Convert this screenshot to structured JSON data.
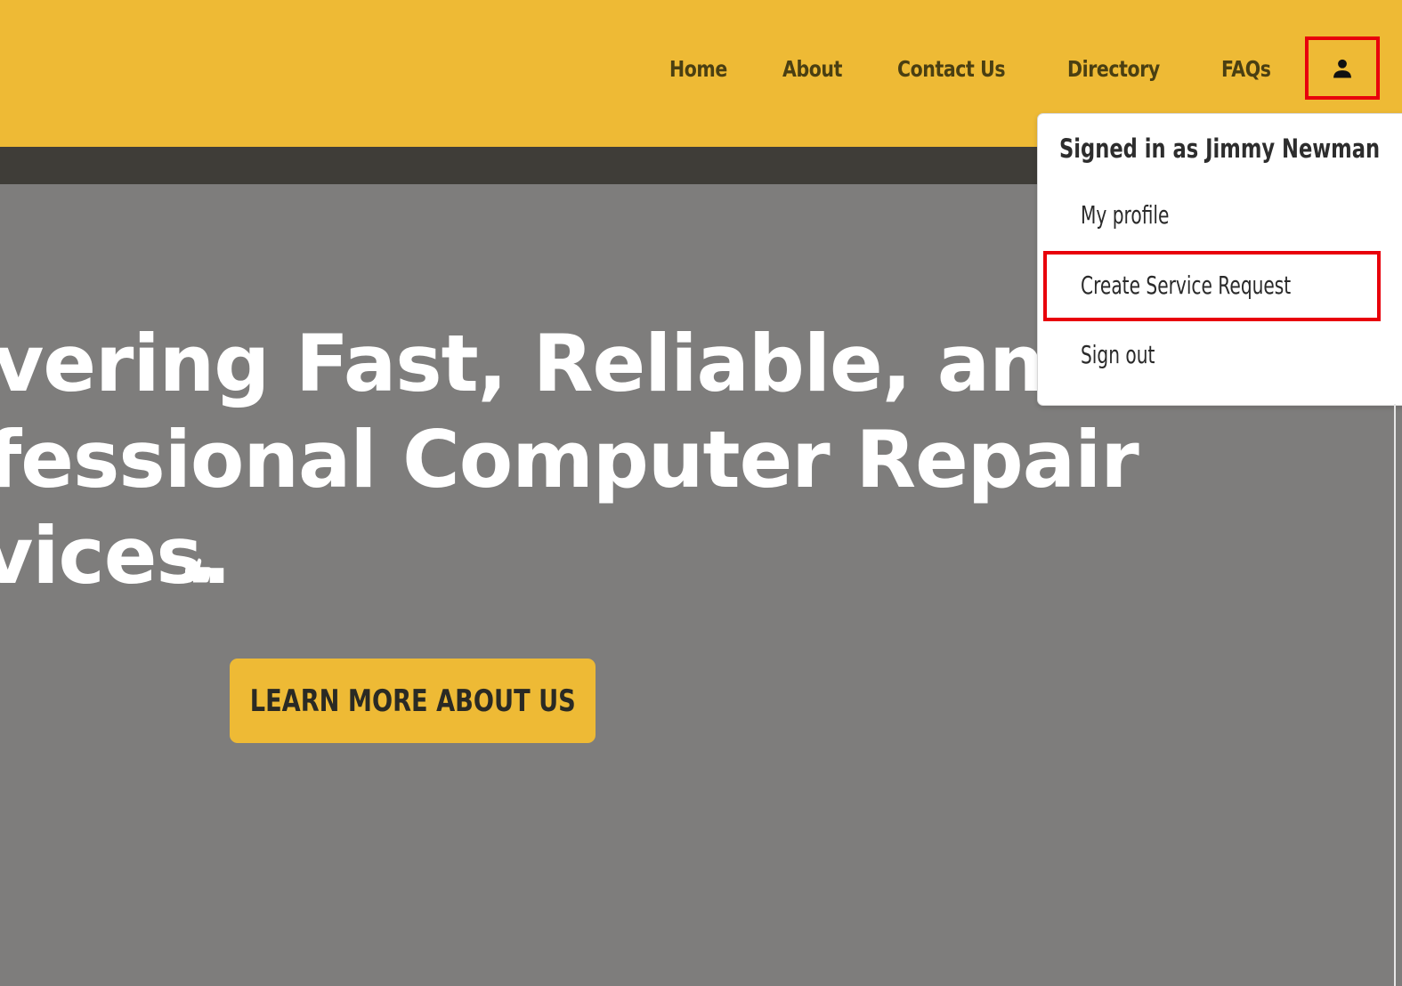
{
  "nav": {
    "items": [
      {
        "label": "Home"
      },
      {
        "label": "About"
      },
      {
        "label": "Contact Us"
      },
      {
        "label": "Directory"
      },
      {
        "label": "FAQs"
      }
    ],
    "user_icon": "person-icon"
  },
  "user_menu": {
    "header": "Signed in as Jimmy Newman",
    "items": [
      {
        "label": "My profile"
      },
      {
        "label": "Create Service Request"
      },
      {
        "label": "Sign out"
      }
    ]
  },
  "hero": {
    "lines": [
      "vering Fast, Reliable, and",
      "fessional Computer Repair",
      "vices."
    ],
    "thumb_icon": "thumbs-up-icon",
    "cta_label": "LEARN MORE ABOUT US"
  },
  "colors": {
    "header_bg": "#eeba35",
    "nav_text": "#4a3f12",
    "dark_bar": "#3f3d38",
    "hero_bg": "#7e7d7c",
    "highlight": "#e8000b"
  }
}
